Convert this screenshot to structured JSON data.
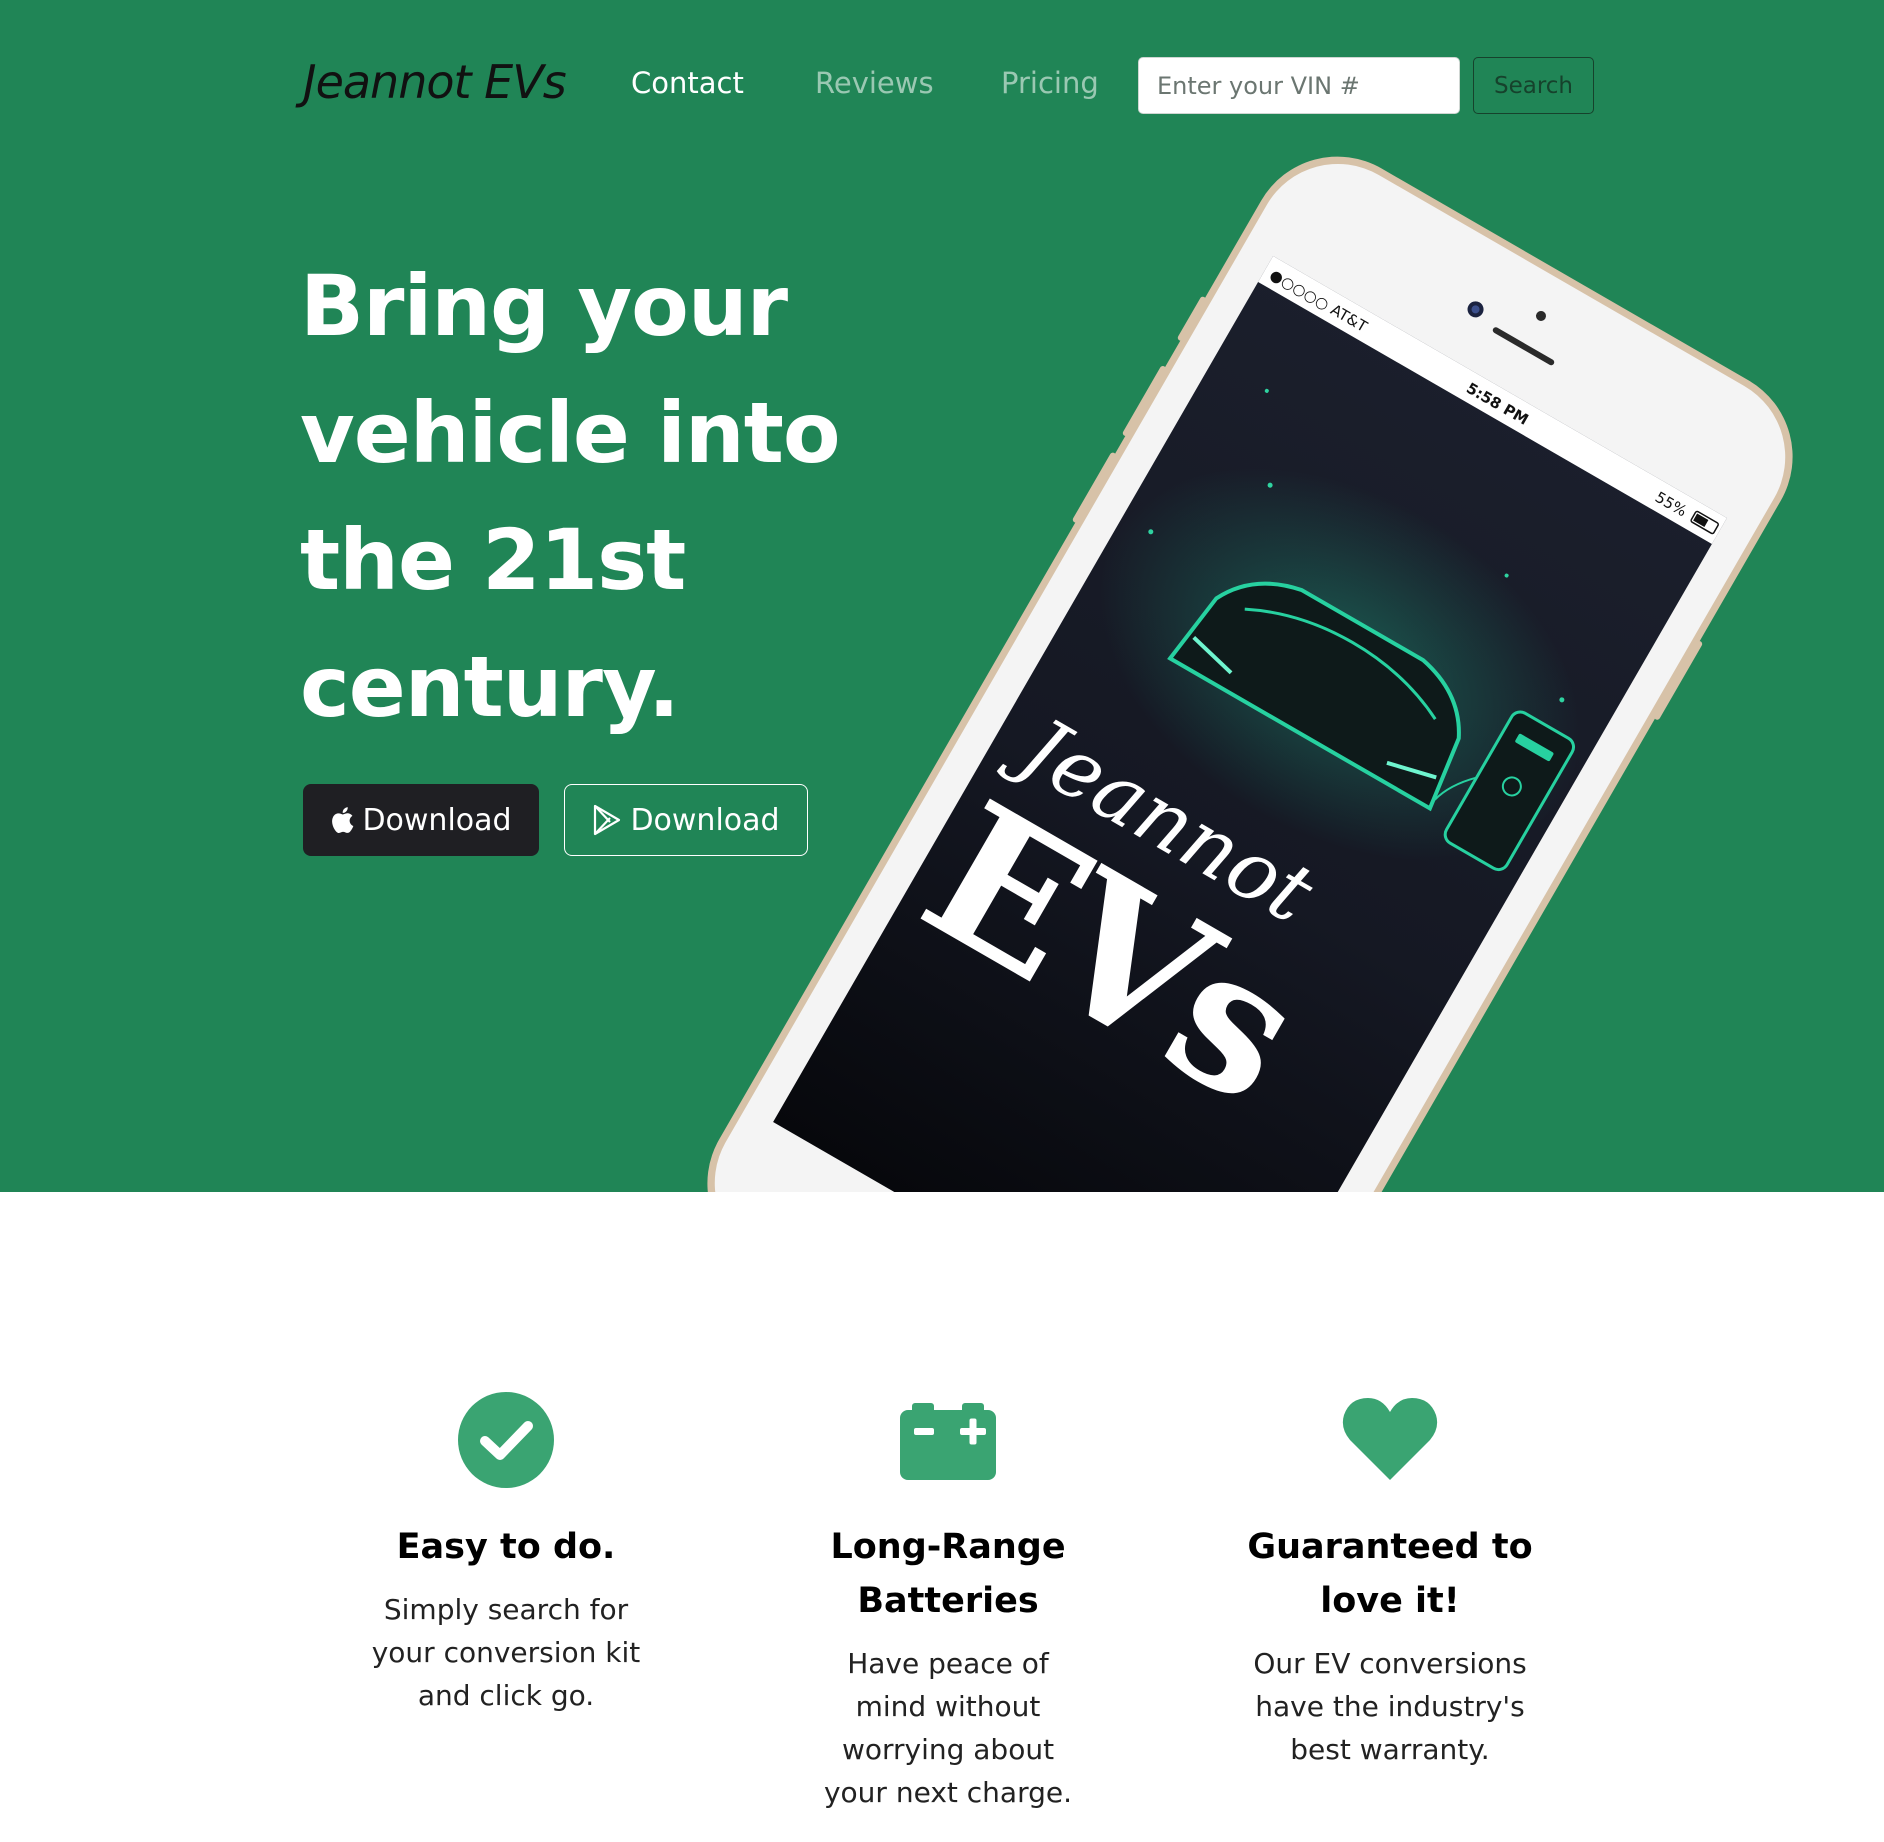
{
  "nav": {
    "brand": "Jeannot EVs",
    "links": [
      "Contact",
      "Reviews",
      "Pricing"
    ],
    "vin_placeholder": "Enter your VIN #",
    "search_label": "Search"
  },
  "hero": {
    "headline": "Bring your vehicle into the 21st century.",
    "apple_download": "Download",
    "play_download": "Download",
    "phone": {
      "carrier": "●○○○○ AT&T",
      "time": "5:58 PM",
      "battery": "55%",
      "logo_script": "Jeannot",
      "logo_main": "EVs"
    }
  },
  "features": [
    {
      "icon": "check-circle-icon",
      "title": "Easy to do.",
      "text": "Simply search for your conversion kit and click go."
    },
    {
      "icon": "battery-icon",
      "title": "Long-Range Batteries",
      "text": "Have peace of mind without worrying about your next charge."
    },
    {
      "icon": "heart-icon",
      "title": "Guaranteed to love it!",
      "text": "Our EV conversions have the industry's best warranty."
    }
  ],
  "colors": {
    "hero_bg": "#208556",
    "icon_green": "#3aa472",
    "apple_button": "#1f1f23"
  }
}
